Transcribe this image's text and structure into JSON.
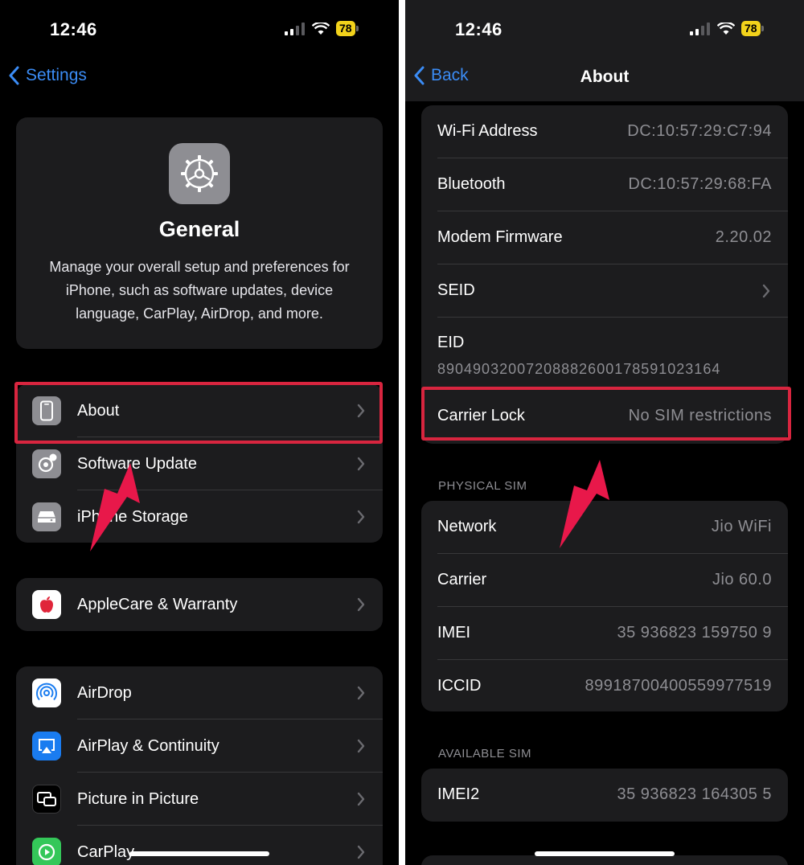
{
  "left_screen": {
    "status": {
      "time": "12:46",
      "battery": "78"
    },
    "nav": {
      "back_label": "Settings"
    },
    "header": {
      "title": "General",
      "description": "Manage your overall setup and preferences for iPhone, such as software updates, device language, CarPlay, AirDrop, and more."
    },
    "group1": [
      {
        "label": "About",
        "icon": "phone-outline-icon"
      },
      {
        "label": "Software Update",
        "icon": "gear-badge-icon"
      },
      {
        "label": "iPhone Storage",
        "icon": "storage-drive-icon"
      }
    ],
    "group2": [
      {
        "label": "AppleCare & Warranty",
        "icon": "apple-logo-icon"
      }
    ],
    "group3": [
      {
        "label": "AirDrop",
        "icon": "airdrop-icon"
      },
      {
        "label": "AirPlay & Continuity",
        "icon": "airplay-icon"
      },
      {
        "label": "Picture in Picture",
        "icon": "picture-in-picture-icon"
      },
      {
        "label": "CarPlay",
        "icon": "carplay-icon"
      }
    ]
  },
  "right_screen": {
    "status": {
      "time": "12:46",
      "battery": "78"
    },
    "nav": {
      "back_label": "Back",
      "title": "About"
    },
    "info_rows": [
      {
        "label": "Wi-Fi Address",
        "value": "DC:10:57:29:C7:94"
      },
      {
        "label": "Bluetooth",
        "value": "DC:10:57:29:68:FA"
      },
      {
        "label": "Modem Firmware",
        "value": "2.20.02"
      },
      {
        "label": "SEID",
        "value": ""
      },
      {
        "label": "EID",
        "value": "89049032007208882600178591023164"
      },
      {
        "label": "Carrier Lock",
        "value": "No SIM restrictions"
      }
    ],
    "physical_sim": {
      "header": "PHYSICAL SIM",
      "rows": [
        {
          "label": "Network",
          "value": "Jio WiFi"
        },
        {
          "label": "Carrier",
          "value": "Jio 60.0"
        },
        {
          "label": "IMEI",
          "value": "35 936823 159750 9"
        },
        {
          "label": "ICCID",
          "value": "8991870040055997751​9"
        }
      ]
    },
    "available_sim": {
      "header": "AVAILABLE SIM",
      "rows": [
        {
          "label": "IMEI2",
          "value": "35 936823 164305 5"
        }
      ]
    }
  },
  "colors": {
    "accent_blue": "#3b8cf5",
    "highlight_red": "#d8253f",
    "arrow_pink": "#e8184a",
    "battery_yellow": "#f2d21b"
  }
}
